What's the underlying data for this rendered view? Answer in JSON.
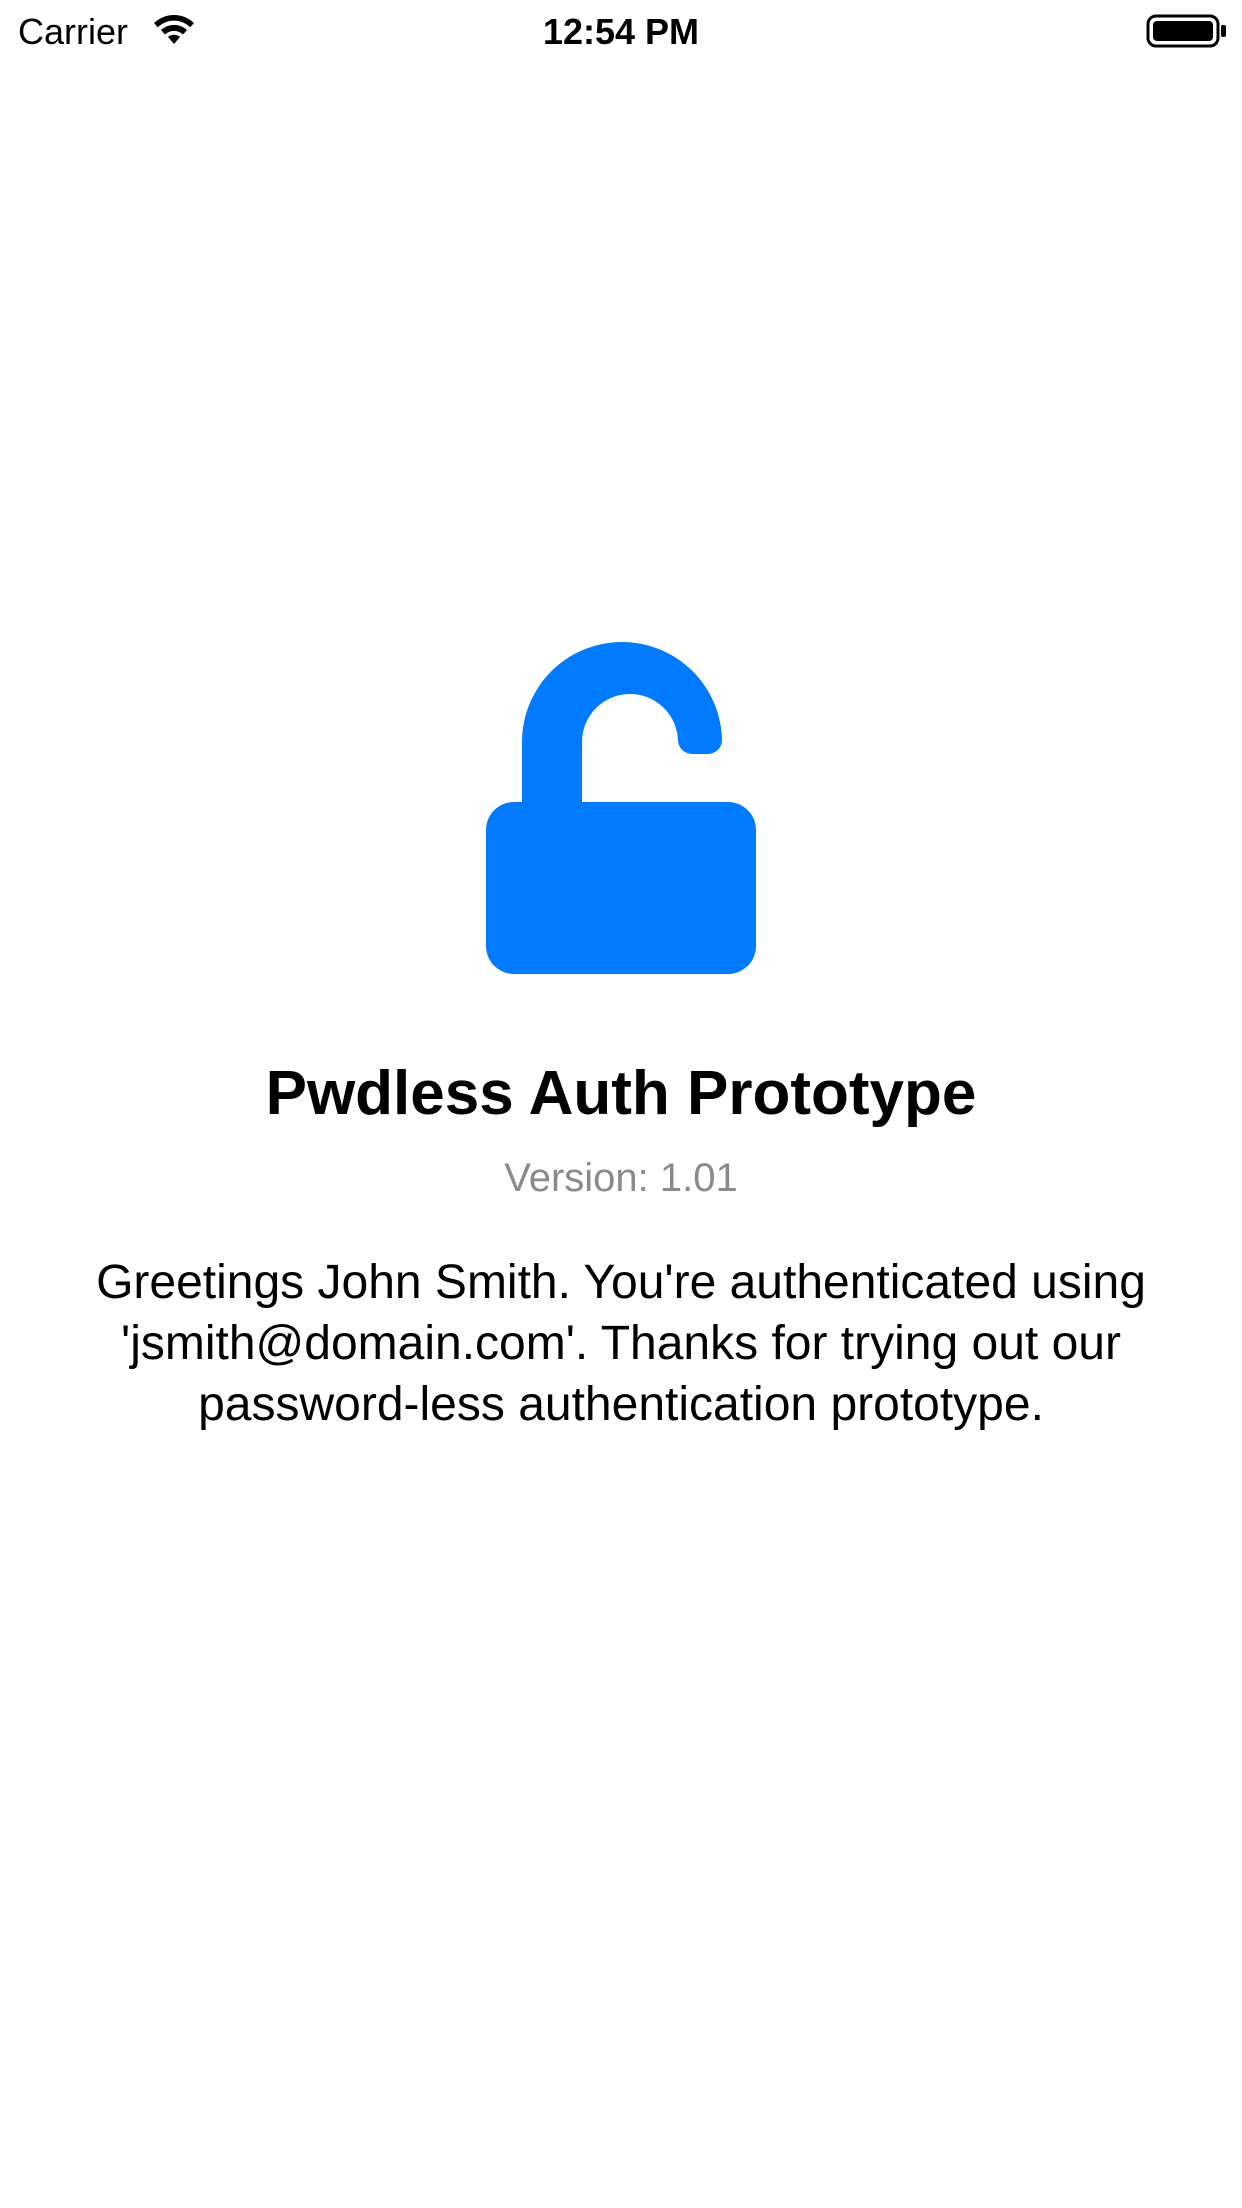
{
  "status_bar": {
    "carrier": "Carrier",
    "time": "12:54 PM",
    "wifi_icon": "wifi-icon",
    "battery_icon": "battery-full-icon"
  },
  "main": {
    "lock_icon": "unlocked-padlock-icon",
    "title": "Pwdless Auth Prototype",
    "version": "Version: 1.01",
    "greeting": "Greetings John Smith.  You're authenticated using 'jsmith@domain.com'.  Thanks for trying out our password-less authentication prototype."
  },
  "colors": {
    "accent": "#007AFF",
    "version_text": "#8A8A8E",
    "background": "#FFFFFF"
  }
}
